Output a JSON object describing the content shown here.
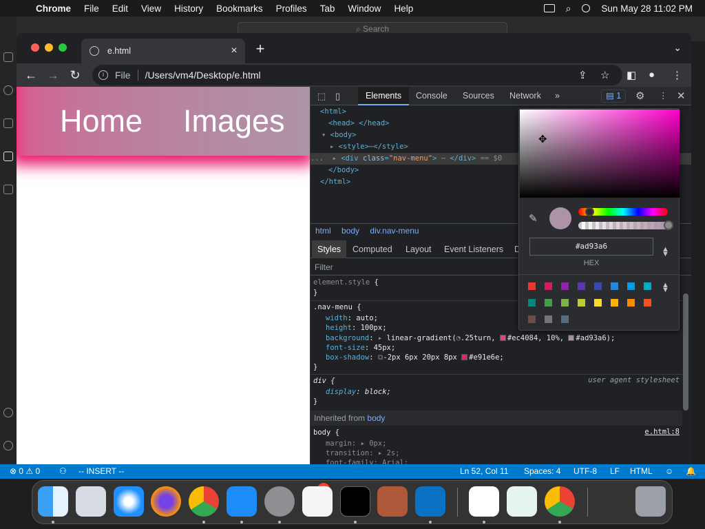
{
  "menubar": {
    "app": "Chrome",
    "items": [
      "File",
      "Edit",
      "View",
      "History",
      "Bookmarks",
      "Profiles",
      "Tab",
      "Window",
      "Help"
    ],
    "datetime": "Sun May 28  11:02 PM"
  },
  "vscode": {
    "search_label": "Search",
    "status": {
      "problems": "⊗ 0 ⚠ 0",
      "mode": "-- INSERT --",
      "position": "Ln 52, Col 11",
      "spaces": "Spaces: 4",
      "encoding": "UTF-8",
      "eol": "LF",
      "language": "HTML"
    }
  },
  "chrome": {
    "tab_title": "e.html",
    "omnibox_scheme": "File",
    "omnibox_url": "/Users/vm4/Desktop/e.html"
  },
  "page": {
    "nav_items": [
      "Home",
      "Images"
    ]
  },
  "devtools": {
    "tabs": [
      "Elements",
      "Console",
      "Sources",
      "Network"
    ],
    "issues_count": "1",
    "breadcrumbs": [
      "html",
      "body",
      "div.nav-menu"
    ],
    "subtabs": [
      "Styles",
      "Computed",
      "Layout",
      "Event Listeners",
      "D"
    ],
    "filter_placeholder": "Filter",
    "ua_label": "user agent stylesheet",
    "inherited_label": "Inherited from",
    "inherited_from": "body",
    "source_link": "e.html:8"
  },
  "color_picker": {
    "hex_value": "#ad93a6",
    "format_label": "HEX",
    "palette": [
      "#e53935",
      "#d81b60",
      "#8e24aa",
      "#5e35b1",
      "#3949ab",
      "#1e88e5",
      "#039be5",
      "#00acc1",
      "#00897b",
      "#43a047",
      "#7cb342",
      "#c0ca33",
      "#fdd835",
      "#ffb300",
      "#fb8c00",
      "#f4511e",
      "#6d4c41",
      "#757575",
      "#546e7a"
    ]
  },
  "colors": {
    "gradient_start": "#ec4084",
    "gradient_end": "#ad93a6",
    "shadow": "#e91e6e",
    "statusbar": "#007acc"
  }
}
